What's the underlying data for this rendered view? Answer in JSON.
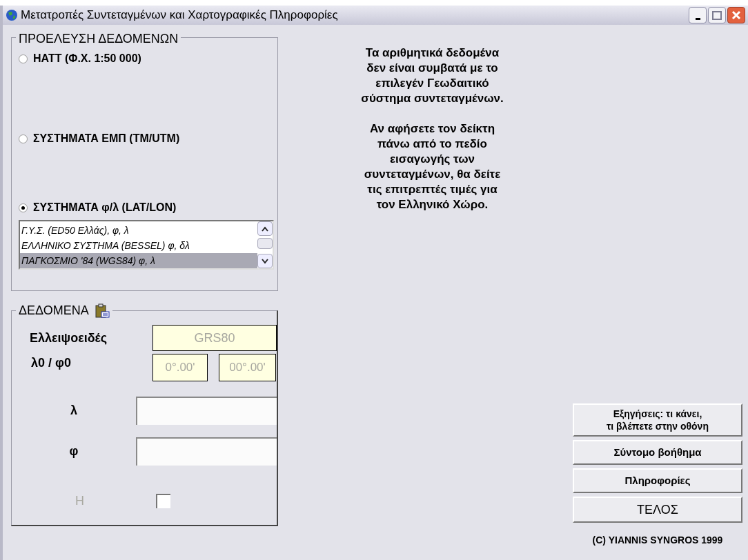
{
  "window": {
    "title": "Μετατροπές Συντεταγμένων και Χαρτογραφικές Πληροφορίες"
  },
  "source_group": {
    "title": "ΠΡΟΕΛΕΥΣΗ ΔΕΔΟΜΕΝΩΝ",
    "options": [
      {
        "label": "HATT (Φ.Χ. 1:50 000)",
        "selected": false
      },
      {
        "label": "ΣΥΣΤΗΜΑΤΑ ΕΜΠ (TM/UTM)",
        "selected": false
      },
      {
        "label": "ΣΥΣΤΗΜΑΤΑ φ/λ (LAT/LON)",
        "selected": true
      }
    ],
    "systems_list": [
      {
        "label": "Γ.Υ.Σ. (ED50 Ελλάς), φ, λ",
        "selected": false
      },
      {
        "label": "ΕΛΛΗΝΙΚΟ ΣΥΣΤΗΜΑ (BESSEL) φ, δλ",
        "selected": false
      },
      {
        "label": "ΠΑΓΚΟΣΜΙΟ '84 (WGS84) φ, λ",
        "selected": true
      }
    ]
  },
  "data_group": {
    "title": "ΔΕΔΟΜΕΝΑ",
    "ellipsoid": {
      "label": "Ελλειψοειδές",
      "value": "GRS80"
    },
    "origin": {
      "label": "λ0 / φ0",
      "lambda0": "0°.00'",
      "phi0": "00°.00'"
    },
    "lambda": {
      "label": "λ"
    },
    "phi": {
      "label": "φ"
    },
    "height": {
      "label": "H",
      "checked": false,
      "disabled": true
    }
  },
  "message": [
    "Τα αριθμητικά δεδομένα δεν είναι συμβατά με το επιλεγέν Γεωδαιτικό σύστημα συντεταγμένων.",
    "Αν αφήσετε τον δείκτη πάνω από το πεδίο εισαγωγής των συντεταγμένων, θα δείτε τις επιτρεπτές τιμές για τον Ελληνικό Χώρο."
  ],
  "buttons": [
    "Εξηγήσεις: τι κάνει,\nτι βλέπετε στην οθόνη",
    "Σύντομο βοήθημα",
    "Πληροφορίες",
    "ΤΕΛΟΣ"
  ],
  "copyright": "(C) YIANNIS SYNGROS 1999"
}
